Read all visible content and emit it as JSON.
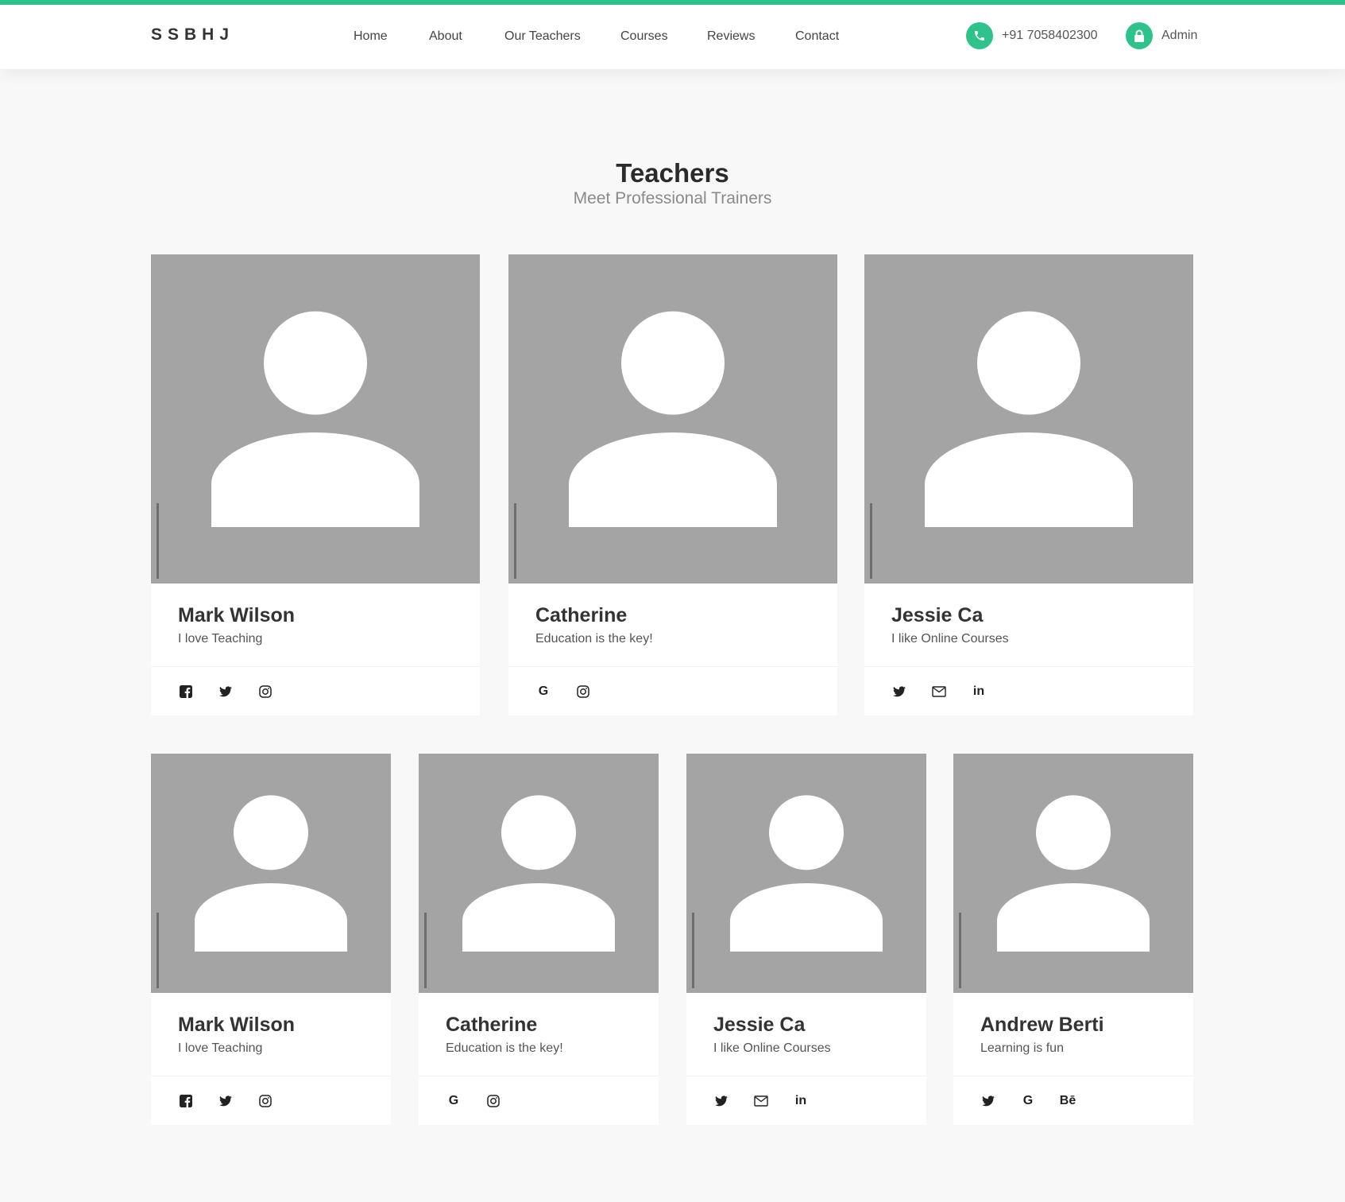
{
  "header": {
    "logo": "SSBHJ",
    "nav": [
      "Home",
      "About",
      "Our Teachers",
      "Courses",
      "Reviews",
      "Contact"
    ],
    "phone": "+91 7058402300",
    "admin": "Admin"
  },
  "section": {
    "title": "Teachers",
    "subtitle": "Meet Professional Trainers"
  },
  "teachers_row1": [
    {
      "name": "Mark Wilson",
      "desc": "I love Teaching",
      "social": [
        "facebook-icon",
        "twitter-icon",
        "instagram-icon"
      ]
    },
    {
      "name": "Catherine",
      "desc": "Education is the key!",
      "social": [
        "google-icon",
        "instagram-icon"
      ]
    },
    {
      "name": "Jessie Ca",
      "desc": "I like Online Courses",
      "social": [
        "twitter-icon",
        "mail-icon",
        "linkedin-icon"
      ]
    }
  ],
  "teachers_row2": [
    {
      "name": "Mark Wilson",
      "desc": "I love Teaching",
      "social": [
        "facebook-icon",
        "twitter-icon",
        "instagram-icon"
      ]
    },
    {
      "name": "Catherine",
      "desc": "Education is the key!",
      "social": [
        "google-icon",
        "instagram-icon"
      ]
    },
    {
      "name": "Jessie Ca",
      "desc": "I like Online Courses",
      "social": [
        "twitter-icon",
        "mail-icon",
        "linkedin-icon"
      ]
    },
    {
      "name": "Andrew Berti",
      "desc": "Learning is fun",
      "social": [
        "twitter-icon",
        "google-icon",
        "behance-icon"
      ]
    }
  ],
  "colors": {
    "accent": "#2dc38a",
    "photo_bg": "#a4a4a4"
  },
  "icon_glyphs": {
    "google": "G",
    "linkedin": "in",
    "behance": "Bē"
  }
}
